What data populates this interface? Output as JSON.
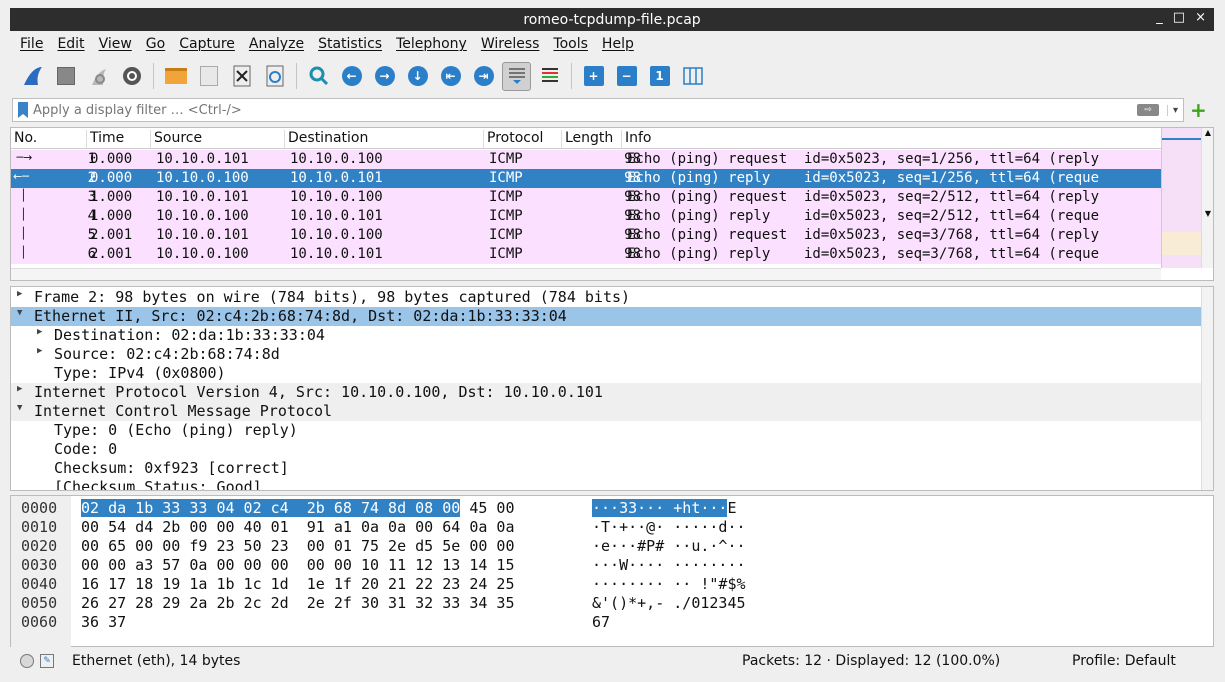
{
  "window": {
    "title": "romeo-tcpdump-file.pcap",
    "controls": [
      "_",
      "□",
      "×"
    ]
  },
  "menu": [
    "File",
    "Edit",
    "View",
    "Go",
    "Capture",
    "Analyze",
    "Statistics",
    "Telephony",
    "Wireless",
    "Tools",
    "Help"
  ],
  "filter": {
    "placeholder": "Apply a display filter … <Ctrl-/>",
    "apply_icon": "arrow-right-icon",
    "add_icon": "plus-icon"
  },
  "packet_list": {
    "columns": [
      "No.",
      "Time",
      "Source",
      "Destination",
      "Protocol",
      "Length",
      "Info"
    ],
    "rows": [
      {
        "no": "1",
        "time": "0.000",
        "src": "10.10.0.101",
        "dst": "10.10.0.100",
        "proto": "ICMP",
        "len": "98",
        "info": "Echo (ping) request  id=0x5023, seq=1/256, ttl=64 (reply"
      },
      {
        "no": "2",
        "time": "0.000",
        "src": "10.10.0.100",
        "dst": "10.10.0.101",
        "proto": "ICMP",
        "len": "98",
        "info": "Echo (ping) reply    id=0x5023, seq=1/256, ttl=64 (reque"
      },
      {
        "no": "3",
        "time": "1.000",
        "src": "10.10.0.101",
        "dst": "10.10.0.100",
        "proto": "ICMP",
        "len": "98",
        "info": "Echo (ping) request  id=0x5023, seq=2/512, ttl=64 (reply"
      },
      {
        "no": "4",
        "time": "1.000",
        "src": "10.10.0.100",
        "dst": "10.10.0.101",
        "proto": "ICMP",
        "len": "98",
        "info": "Echo (ping) reply    id=0x5023, seq=2/512, ttl=64 (reque"
      },
      {
        "no": "5",
        "time": "2.001",
        "src": "10.10.0.101",
        "dst": "10.10.0.100",
        "proto": "ICMP",
        "len": "98",
        "info": "Echo (ping) request  id=0x5023, seq=3/768, ttl=64 (reply"
      },
      {
        "no": "6",
        "time": "2.001",
        "src": "10.10.0.100",
        "dst": "10.10.0.101",
        "proto": "ICMP",
        "len": "98",
        "info": "Echo (ping) reply    id=0x5023, seq=3/768, ttl=64 (reque"
      }
    ],
    "selected_row_color": "#3182c4",
    "icmp_row_color": "#fce0ff"
  },
  "details": [
    {
      "indent": 0,
      "expand": "collapsed",
      "text": "Frame 2: 98 bytes on wire (784 bits), 98 bytes captured (784 bits)"
    },
    {
      "indent": 0,
      "expand": "expanded",
      "text": "Ethernet II, Src: 02:c4:2b:68:74:8d, Dst: 02:da:1b:33:33:04",
      "selected": true
    },
    {
      "indent": 1,
      "expand": "collapsed",
      "text": "Destination: 02:da:1b:33:33:04"
    },
    {
      "indent": 1,
      "expand": "collapsed",
      "text": "Source: 02:c4:2b:68:74:8d"
    },
    {
      "indent": 1,
      "expand": "none",
      "text": "Type: IPv4 (0x0800)"
    },
    {
      "indent": 0,
      "expand": "collapsed",
      "text": "Internet Protocol Version 4, Src: 10.10.0.100, Dst: 10.10.0.101"
    },
    {
      "indent": 0,
      "expand": "expanded",
      "text": "Internet Control Message Protocol"
    },
    {
      "indent": 1,
      "expand": "none",
      "text": "Type: 0 (Echo (ping) reply)"
    },
    {
      "indent": 1,
      "expand": "none",
      "text": "Code: 0"
    },
    {
      "indent": 1,
      "expand": "none",
      "text": "Checksum: 0xf923 [correct]"
    },
    {
      "indent": 1,
      "expand": "none",
      "text": "[Checksum Status: Good]"
    }
  ],
  "bytes": [
    {
      "off": "0000",
      "hex_hl": "02 da 1b 33 33 04 02 c4  2b 68 74 8d 08 00",
      "hex_rest": " 45 00",
      "ascii_hl": "···33··· +ht···",
      "ascii_rest": "E"
    },
    {
      "off": "0010",
      "hex_hl": "",
      "hex_rest": "00 54 d4 2b 00 00 40 01  91 a1 0a 0a 00 64 0a 0a",
      "ascii_hl": "",
      "ascii_rest": "·T·+··@· ·····d··"
    },
    {
      "off": "0020",
      "hex_hl": "",
      "hex_rest": "00 65 00 00 f9 23 50 23  00 01 75 2e d5 5e 00 00",
      "ascii_hl": "",
      "ascii_rest": "·e···#P# ··u.·^··"
    },
    {
      "off": "0030",
      "hex_hl": "",
      "hex_rest": "00 00 a3 57 0a 00 00 00  00 00 10 11 12 13 14 15",
      "ascii_hl": "",
      "ascii_rest": "···W···· ········"
    },
    {
      "off": "0040",
      "hex_hl": "",
      "hex_rest": "16 17 18 19 1a 1b 1c 1d  1e 1f 20 21 22 23 24 25",
      "ascii_hl": "",
      "ascii_rest": "········ ·· !\"#$%"
    },
    {
      "off": "0050",
      "hex_hl": "",
      "hex_rest": "26 27 28 29 2a 2b 2c 2d  2e 2f 30 31 32 33 34 35",
      "ascii_hl": "",
      "ascii_rest": "&'()*+,- ./012345"
    },
    {
      "off": "0060",
      "hex_hl": "",
      "hex_rest": "36 37",
      "ascii_hl": "",
      "ascii_rest": "67"
    }
  ],
  "status": {
    "field": "Ethernet (eth), 14 bytes",
    "packets": "Packets: 12 · Displayed: 12 (100.0%)",
    "profile": "Profile: Default"
  },
  "toolbar": [
    "shark-fin-icon",
    "stop-icon",
    "restart-icon",
    "options-gear-icon",
    "open-folder-icon",
    "save-icon",
    "close-file-icon",
    "reload-icon",
    "find-icon",
    "go-back-icon",
    "go-forward-icon",
    "go-to-packet-icon",
    "first-packet-icon",
    "last-packet-icon",
    "autoscroll-icon",
    "colorize-icon",
    "zoom-in-icon",
    "zoom-out-icon",
    "normal-size-icon",
    "resize-columns-icon"
  ]
}
